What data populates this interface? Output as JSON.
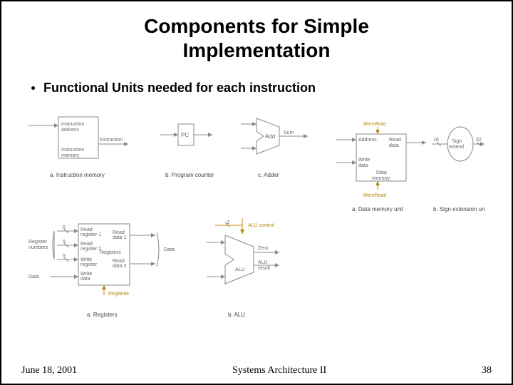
{
  "title_line1": "Components for Simple",
  "title_line2": "Implementation",
  "bullet": "Functional Units needed for each instruction",
  "footer": {
    "left": "June 18, 2001",
    "center": "Systems Architecture II",
    "right": "38"
  },
  "labels": {
    "instr_addr": "Instruction\naddress",
    "instruction": "Instruction",
    "instr_mem_box": "Instruction\nmemory",
    "a_caption": "a. Instruction memory",
    "pc": "PC",
    "b_caption": "b. Program counter",
    "add": "Add",
    "sum": "Sum",
    "c_caption": "c. Adder",
    "memwrite": "MemWrite",
    "address": "Address",
    "readdata": "Read\ndata",
    "writedata": "Write\ndata",
    "datamemory": "Data\nmemory",
    "memread": "MemRead",
    "a2_caption": "a. Data memory unit",
    "sixteen": "16",
    "thirtytwo": "32",
    "signext": "Sign\nextend",
    "b2_caption": "b. Sign extension unit",
    "regnumbers": "Register\nnumbers",
    "five": "5",
    "readreg1": "Read\nregister 1",
    "readreg2": "Read\nregister 2",
    "writereg": "Write\nregister",
    "writedata2": "Write\ndata",
    "data_lbl": "Data",
    "registers": "Registers",
    "readdata1": "Read\ndata 1",
    "readdata2": "Read\ndata 2",
    "data_out": "Data",
    "regwrite": "RegWrite",
    "a3_caption": "a. Registers",
    "three": "3",
    "alucontrol": "ALU control",
    "zero": "Zero",
    "alu": "ALU",
    "aluresult": "ALU\nresult",
    "b3_caption": "b. ALU"
  }
}
